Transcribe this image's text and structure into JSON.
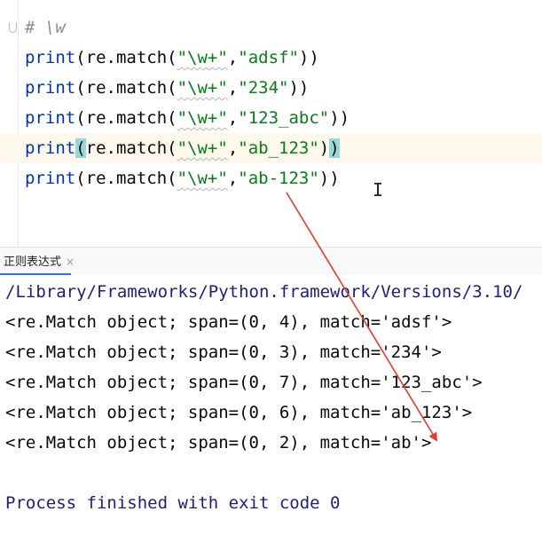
{
  "editor": {
    "comment": "# \\w",
    "lines": [
      {
        "func": "print",
        "mid": "(re.match(",
        "pattern": "\"\\w+\"",
        "sep": ",",
        "arg": "\"adsf\"",
        "close": "))"
      },
      {
        "func": "print",
        "mid": "(re.match(",
        "pattern": "\"\\w+\"",
        "sep": ",",
        "arg": "\"234\"",
        "close": "))"
      },
      {
        "func": "print",
        "mid": "(re.match(",
        "pattern": "\"\\w+\"",
        "sep": ",",
        "arg": "\"123_abc\"",
        "close": "))"
      },
      {
        "func": "print",
        "open_hl": "(",
        "mid": "re.match(",
        "pattern": "\"\\w+\"",
        "sep": ",",
        "arg": "\"ab_123\"",
        "close": ")",
        "close_hl": ")"
      },
      {
        "func": "print",
        "mid": "(re.match(",
        "pattern": "\"\\w+\"",
        "sep": ",",
        "arg": "\"ab-123\"",
        "close": "))"
      }
    ]
  },
  "run_panel": {
    "tab_label": "正则表达式",
    "close_glyph": "×"
  },
  "console": {
    "path_line": "/Library/Frameworks/Python.framework/Versions/3.10/",
    "outputs": [
      "<re.Match object; span=(0, 4), match='adsf'>",
      "<re.Match object; span=(0, 3), match='234'>",
      "<re.Match object; span=(0, 7), match='123_abc'>",
      "<re.Match object; span=(0, 6), match='ab_123'>",
      "<re.Match object; span=(0, 2), match='ab'>"
    ],
    "finish": "Process finished with exit code 0"
  },
  "colors": {
    "keyword": "#0033b3",
    "string": "#067d17",
    "annotation_arrow": "#e8392b",
    "brace_highlight": "#93d9d9"
  }
}
